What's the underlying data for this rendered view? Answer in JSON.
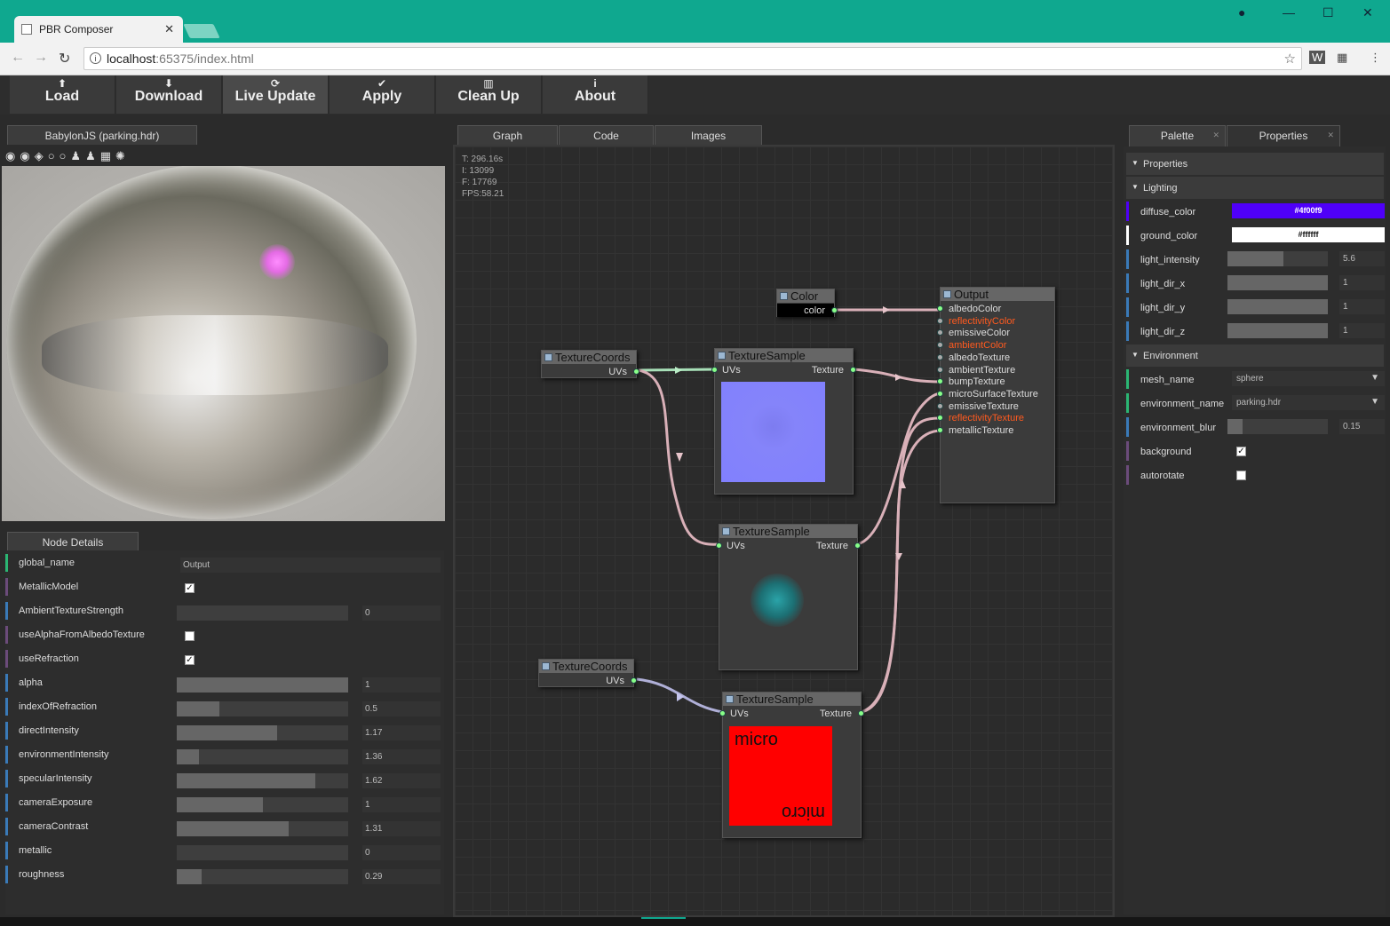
{
  "browser": {
    "tab_title": "PBR Composer",
    "url_host": "localhost",
    "url_rest": ":65375/index.html"
  },
  "toolbar": {
    "buttons": [
      {
        "label": "Load",
        "icon": "upload-icon"
      },
      {
        "label": "Download",
        "icon": "download-icon"
      },
      {
        "label": "Live Update",
        "icon": "refresh-icon"
      },
      {
        "label": "Apply",
        "icon": "check-circle-icon"
      },
      {
        "label": "Clean Up",
        "icon": "trash-icon"
      },
      {
        "label": "About",
        "icon": "info-icon"
      }
    ]
  },
  "viewer": {
    "tab": "BabylonJS (parking.hdr)"
  },
  "node_details": {
    "tab": "Node Details",
    "rows": [
      {
        "label": "global_name",
        "type": "text",
        "value": "Output"
      },
      {
        "label": "MetallicModel",
        "type": "check",
        "checked": true
      },
      {
        "label": "AmbientTextureStrength",
        "type": "slider",
        "value": "0",
        "fraction": 0
      },
      {
        "label": "useAlphaFromAlbedoTexture",
        "type": "check",
        "checked": false
      },
      {
        "label": "useRefraction",
        "type": "check",
        "checked": true
      },
      {
        "label": "alpha",
        "type": "slider",
        "value": "1",
        "fraction": 1
      },
      {
        "label": "indexOfRefraction",
        "type": "slider",
        "value": "0.5",
        "fraction": 0.25
      },
      {
        "label": "directIntensity",
        "type": "slider",
        "value": "1.17",
        "fraction": 0.585
      },
      {
        "label": "environmentIntensity",
        "type": "slider",
        "value": "1.36",
        "fraction": 0.13
      },
      {
        "label": "specularIntensity",
        "type": "slider",
        "value": "1.62",
        "fraction": 0.81
      },
      {
        "label": "cameraExposure",
        "type": "slider",
        "value": "1",
        "fraction": 0.5
      },
      {
        "label": "cameraContrast",
        "type": "slider",
        "value": "1.31",
        "fraction": 0.655
      },
      {
        "label": "metallic",
        "type": "slider",
        "value": "0",
        "fraction": 0
      },
      {
        "label": "roughness",
        "type": "slider",
        "value": "0.29",
        "fraction": 0.145
      }
    ]
  },
  "graph": {
    "tabs": [
      "Graph",
      "Code",
      "Images"
    ],
    "stats": [
      "T: 296.16s",
      "I: 13099",
      "F: 17769",
      "FPS:58.21"
    ],
    "nodes": {
      "color": {
        "title": "Color",
        "port": "color"
      },
      "coords1": {
        "title": "TextureCoords",
        "port": "UVs"
      },
      "coords2": {
        "title": "TextureCoords",
        "port": "UVs"
      },
      "sample1": {
        "title": "TextureSample",
        "in": "UVs",
        "out": "Texture"
      },
      "sample2": {
        "title": "TextureSample",
        "in": "UVs",
        "out": "Texture"
      },
      "sample3": {
        "title": "TextureSample",
        "in": "UVs",
        "out": "Texture",
        "image_text": "micro",
        "image_text_flipped": "micro"
      },
      "output": {
        "title": "Output",
        "ports": [
          {
            "label": "albedoColor",
            "connected": true,
            "highlight": false
          },
          {
            "label": "reflectivityColor",
            "connected": false,
            "highlight": true
          },
          {
            "label": "emissiveColor",
            "connected": false,
            "highlight": false
          },
          {
            "label": "ambientColor",
            "connected": false,
            "highlight": true
          },
          {
            "label": "albedoTexture",
            "connected": false,
            "highlight": false
          },
          {
            "label": "ambientTexture",
            "connected": false,
            "highlight": false
          },
          {
            "label": "bumpTexture",
            "connected": true,
            "highlight": false
          },
          {
            "label": "microSurfaceTexture",
            "connected": true,
            "highlight": false
          },
          {
            "label": "emissiveTexture",
            "connected": false,
            "highlight": false
          },
          {
            "label": "reflectivityTexture",
            "connected": true,
            "highlight": true
          },
          {
            "label": "metallicTexture",
            "connected": true,
            "highlight": false
          }
        ]
      }
    }
  },
  "right": {
    "tabs": [
      "Palette",
      "Properties"
    ],
    "sections": {
      "properties": "Properties",
      "lighting": "Lighting",
      "environment": "Environment"
    },
    "lighting": {
      "diffuse_color": {
        "label": "diffuse_color",
        "value": "#4f00f9"
      },
      "ground_color": {
        "label": "ground_color",
        "value": "#ffffff"
      },
      "light_intensity": {
        "label": "light_intensity",
        "value": "5.6",
        "fraction": 0.56
      },
      "light_dir_x": {
        "label": "light_dir_x",
        "value": "1",
        "fraction": 1
      },
      "light_dir_y": {
        "label": "light_dir_y",
        "value": "1",
        "fraction": 1
      },
      "light_dir_z": {
        "label": "light_dir_z",
        "value": "1",
        "fraction": 1
      }
    },
    "environment": {
      "mesh_name": {
        "label": "mesh_name",
        "value": "sphere"
      },
      "environment_name": {
        "label": "environment_name",
        "value": "parking.hdr"
      },
      "environment_blur": {
        "label": "environment_blur",
        "value": "0.15",
        "fraction": 0.15
      },
      "background": {
        "label": "background",
        "checked": true
      },
      "autorotate": {
        "label": "autorotate",
        "checked": false
      }
    }
  },
  "colors": {
    "accent": "#0fa88f",
    "highlight_port": "#ff5a1f"
  }
}
